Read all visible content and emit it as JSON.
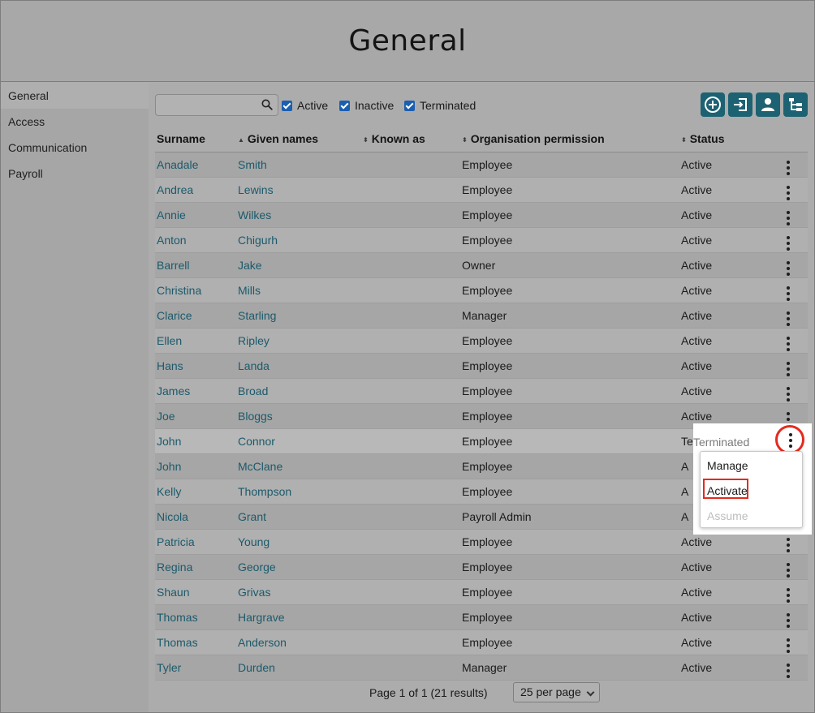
{
  "page": {
    "title": "General"
  },
  "sidebar": {
    "items": [
      {
        "label": "General",
        "active": true
      },
      {
        "label": "Access"
      },
      {
        "label": "Communication"
      },
      {
        "label": "Payroll"
      }
    ]
  },
  "toolbar": {
    "search": {
      "value": "",
      "placeholder": "",
      "icon": "search-icon"
    },
    "filters": [
      {
        "label": "Active",
        "checked": true
      },
      {
        "label": "Inactive",
        "checked": true
      },
      {
        "label": "Terminated",
        "checked": true
      }
    ],
    "actions": [
      {
        "icon": "add-circle-icon"
      },
      {
        "icon": "import-icon"
      },
      {
        "icon": "person-icon"
      },
      {
        "icon": "org-tree-icon"
      }
    ],
    "accent_color": "#1d6272"
  },
  "table": {
    "columns": [
      "Surname",
      "Given names",
      "Known as",
      "Organisation permission",
      "Status"
    ],
    "rows": [
      {
        "surname": "Anadale",
        "given": "Smith",
        "known": "",
        "permission": "Employee",
        "status": "Active"
      },
      {
        "surname": "Andrea",
        "given": "Lewins",
        "known": "",
        "permission": "Employee",
        "status": "Active"
      },
      {
        "surname": "Annie",
        "given": "Wilkes",
        "known": "",
        "permission": "Employee",
        "status": "Active"
      },
      {
        "surname": "Anton",
        "given": "Chigurh",
        "known": "",
        "permission": "Employee",
        "status": "Active"
      },
      {
        "surname": "Barrell",
        "given": "Jake",
        "known": "",
        "permission": "Owner",
        "status": "Active"
      },
      {
        "surname": "Christina",
        "given": "Mills",
        "known": "",
        "permission": "Employee",
        "status": "Active"
      },
      {
        "surname": "Clarice",
        "given": "Starling",
        "known": "",
        "permission": "Manager",
        "status": "Active"
      },
      {
        "surname": "Ellen",
        "given": "Ripley",
        "known": "",
        "permission": "Employee",
        "status": "Active"
      },
      {
        "surname": "Hans",
        "given": "Landa",
        "known": "",
        "permission": "Employee",
        "status": "Active"
      },
      {
        "surname": "James",
        "given": "Broad",
        "known": "",
        "permission": "Employee",
        "status": "Active"
      },
      {
        "surname": "Joe",
        "given": "Bloggs",
        "known": "",
        "permission": "Employee",
        "status": "Active"
      },
      {
        "surname": "John",
        "given": "Connor",
        "known": "",
        "permission": "Employee",
        "status": "Terminated"
      },
      {
        "surname": "John",
        "given": "McClane",
        "known": "",
        "permission": "Employee",
        "status": "A"
      },
      {
        "surname": "Kelly",
        "given": "Thompson",
        "known": "",
        "permission": "Employee",
        "status": "A"
      },
      {
        "surname": "Nicola",
        "given": "Grant",
        "known": "",
        "permission": "Payroll Admin",
        "status": "A"
      },
      {
        "surname": "Patricia",
        "given": "Young",
        "known": "",
        "permission": "Employee",
        "status": "Active"
      },
      {
        "surname": "Regina",
        "given": "George",
        "known": "",
        "permission": "Employee",
        "status": "Active"
      },
      {
        "surname": "Shaun",
        "given": "Grivas",
        "known": "",
        "permission": "Employee",
        "status": "Active"
      },
      {
        "surname": "Thomas",
        "given": "Hargrave",
        "known": "",
        "permission": "Employee",
        "status": "Active"
      },
      {
        "surname": "Thomas",
        "given": "Anderson",
        "known": "",
        "permission": "Employee",
        "status": "Active"
      },
      {
        "surname": "Tyler",
        "given": "Durden",
        "known": "",
        "permission": "Manager",
        "status": "Active"
      }
    ]
  },
  "row_menu": {
    "status_label": "Terminated",
    "items": [
      {
        "label": "Manage",
        "enabled": true
      },
      {
        "label": "Activate",
        "enabled": true,
        "highlighted": true
      },
      {
        "label": "Assume",
        "enabled": false
      }
    ],
    "highlight_color": "#e42b1e"
  },
  "pager": {
    "info": "Page 1 of 1 (21 results)",
    "per_page": "25 per page"
  }
}
